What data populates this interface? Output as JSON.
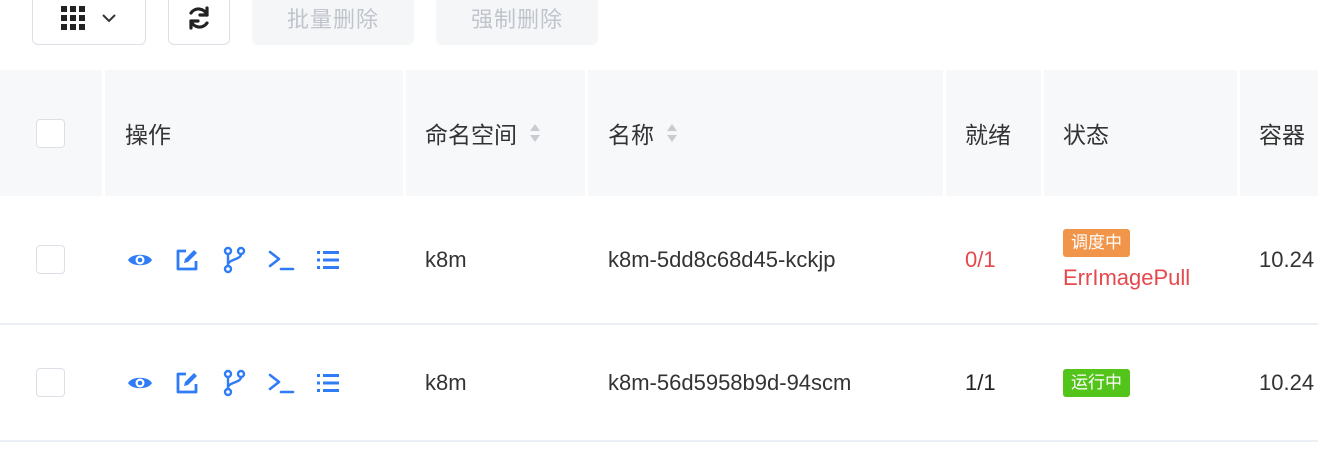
{
  "toolbar": {
    "batch_delete_label": "批量删除",
    "force_delete_label": "强制删除"
  },
  "table": {
    "headers": {
      "actions": "操作",
      "namespace": "命名空间",
      "name": "名称",
      "ready": "就绪",
      "status": "状态",
      "container_ip": "容器"
    },
    "rows": [
      {
        "namespace": "k8m",
        "name": "k8m-5dd8c68d45-kckjp",
        "ready": "0/1",
        "status_tag": "调度中",
        "status_detail": "ErrImagePull",
        "ip": "10.24"
      },
      {
        "namespace": "k8m",
        "name": "k8m-56d5958b9d-94scm",
        "ready": "1/1",
        "status_tag": "运行中",
        "status_detail": "",
        "ip": "10.24"
      }
    ]
  },
  "colors": {
    "accent": "#2f7cf6",
    "error": "#e5484d",
    "tag_scheduling": "#f0954a",
    "tag_running": "#52c41a",
    "header_bg": "#f7f8fa"
  },
  "icons": [
    "grid-icon",
    "chevron-down-icon",
    "refresh-icon",
    "eye-icon",
    "edit-icon",
    "branch-icon",
    "terminal-icon",
    "list-icon"
  ]
}
